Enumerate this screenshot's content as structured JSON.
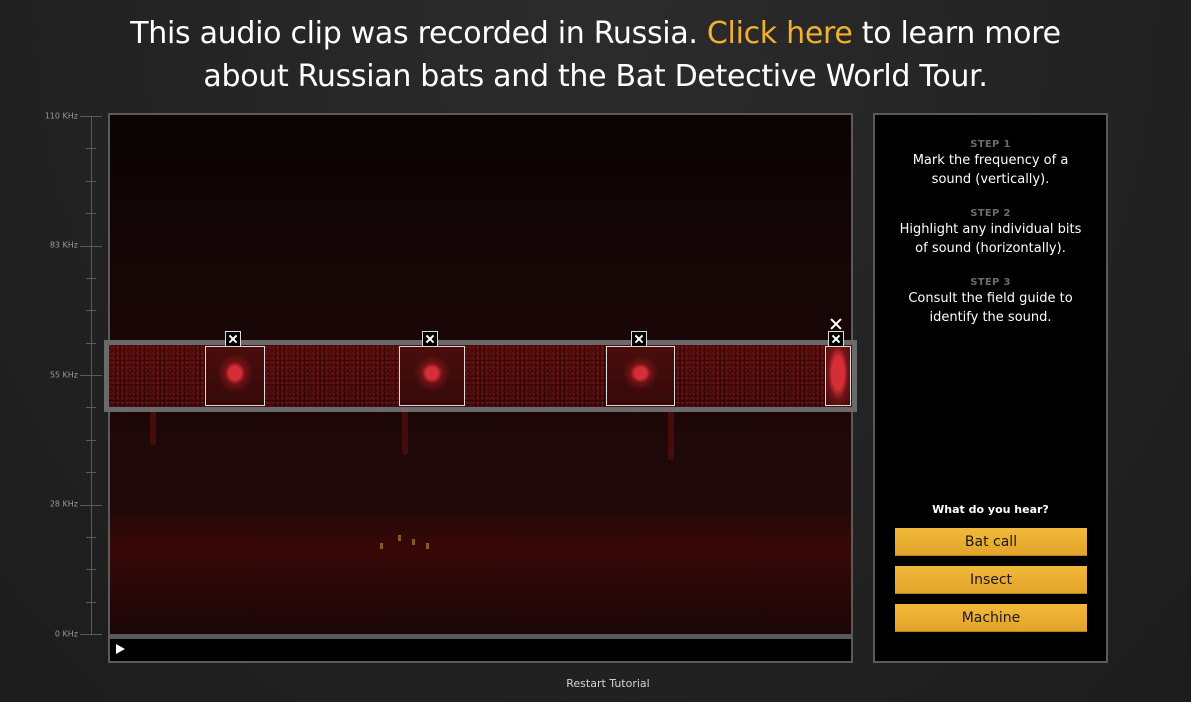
{
  "header": {
    "text_before": "This audio clip was recorded in Russia. ",
    "link_text": "Click here",
    "text_after": " to learn more",
    "line2": "about Russian bats and the Bat Detective World Tour.",
    "link_color": "#f1b12d"
  },
  "axis": {
    "labels": [
      "110 KHz",
      "83 KHz",
      "55 KHz",
      "28 KHz",
      "0 KHz"
    ]
  },
  "player": {
    "play_icon": "play-icon",
    "progress": 0
  },
  "panel": {
    "steps": [
      {
        "label": "STEP 1",
        "text": "Mark the frequency of a sound (vertically)."
      },
      {
        "label": "STEP 2",
        "text": "Highlight any individual bits of sound (horizontally)."
      },
      {
        "label": "STEP 3",
        "text": "Consult the field guide to identify the sound."
      }
    ],
    "question": "What do you hear?",
    "answers": [
      "Bat call",
      "Insect",
      "Machine"
    ],
    "accent_color": "#e8ab30"
  },
  "footer": {
    "restart": "Restart Tutorial"
  }
}
